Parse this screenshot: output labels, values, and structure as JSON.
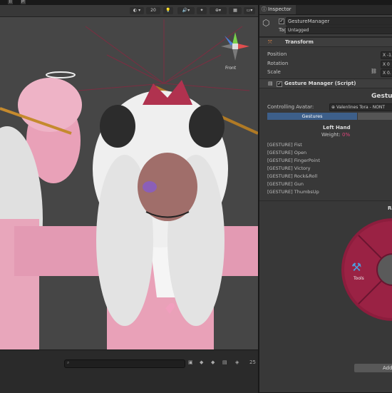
{
  "topbar": {
    "btn1": "II",
    "btn2": "P!"
  },
  "scene": {
    "toolbar": {
      "shading_value": "20"
    },
    "gizmo": {
      "front_label": "Front"
    },
    "bottom": {
      "count": "25"
    },
    "colors": {
      "bg": "#464646",
      "pink": "#e9a1b8",
      "hair": "#e8e8e8",
      "accent": "#c2185b"
    }
  },
  "inspector": {
    "tab_label": "Inspector",
    "object_name": "GestureManager",
    "tag_label": "Tag",
    "tag_value": "Untagged",
    "transform": {
      "title": "Transform",
      "position_label": "Position",
      "rotation_label": "Rotation",
      "scale_label": "Scale",
      "position_x": "X -1.",
      "rotation_x": "X 0",
      "scale_x": "X 0."
    },
    "gm": {
      "title": "Gesture Manager (Script)",
      "header": "Gestu",
      "controlling_label": "Controlling Avatar:",
      "controlling_value": "Valenlines Tora - NONT",
      "tab_gestures": "Gestures",
      "hand_title": "Left Hand",
      "weight_label": "Weight:",
      "weight_value": "0%",
      "gestures": [
        "[GESTURE] Fist",
        "[GESTURE] Open",
        "[GESTURE] FingerPoint",
        "[GESTURE] Victory",
        "[GESTURE] Rock&Roll",
        "[GESTURE] Gun",
        "[GESTURE] ThumbsUp"
      ],
      "radial_label": "Ra",
      "tools_label": "Tools",
      "add_label": "Add"
    }
  }
}
